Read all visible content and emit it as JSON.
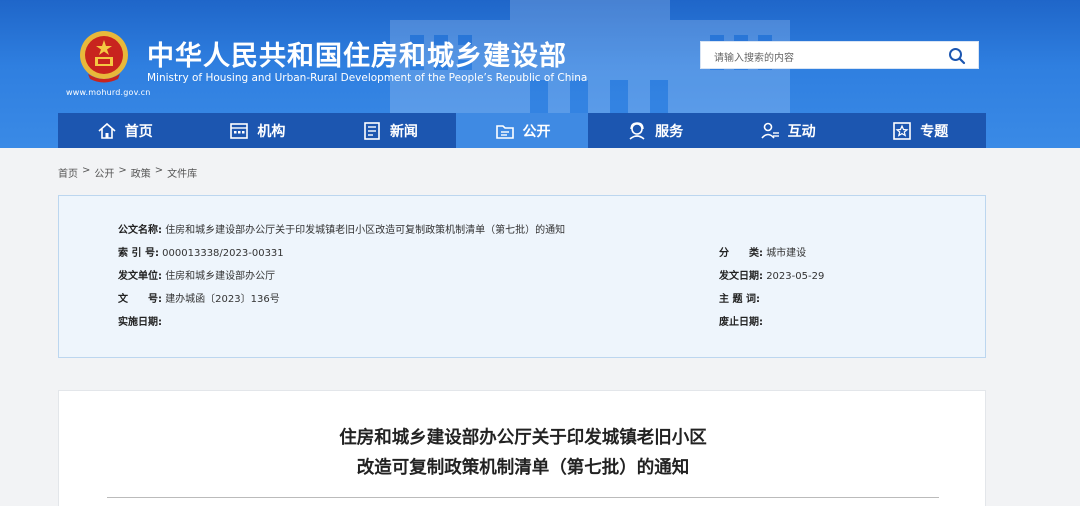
{
  "header": {
    "site_title": "中华人民共和国住房和城乡建设部",
    "site_subtitle": "Ministry of Housing and Urban-Rural Development of the People’s Republic of China",
    "site_url": "www.mohurd.gov.cn",
    "emblem_icon": "national-emblem-icon",
    "colors": {
      "header_bg": "#2f7fe0",
      "nav_bg": "#1c56b0",
      "nav_active": "#3f8ae3"
    }
  },
  "search": {
    "placeholder": "请输入搜索的内容",
    "icon": "search-icon"
  },
  "nav": {
    "items": [
      {
        "label": "首页",
        "icon": "home-icon"
      },
      {
        "label": "机构",
        "icon": "building-icon"
      },
      {
        "label": "新闻",
        "icon": "newspaper-icon"
      },
      {
        "label": "公开",
        "icon": "folder-icon",
        "active": true
      },
      {
        "label": "服务",
        "icon": "service-icon"
      },
      {
        "label": "互动",
        "icon": "interaction-icon"
      },
      {
        "label": "专题",
        "icon": "star-icon"
      }
    ]
  },
  "breadcrumb": {
    "items": [
      "首页",
      "公开",
      "政策",
      "文件库"
    ],
    "separator": ">"
  },
  "info": {
    "doc_name_label": "公文名称:",
    "doc_name_value": "住房和城乡建设部办公厅关于印发城镇老旧小区改造可复制政策机制清单（第七批）的通知",
    "index_label": "索 引 号:",
    "index_value": "000013338/2023-00331",
    "category_label": "分　　类:",
    "category_value": "城市建设",
    "issuer_label": "发文单位:",
    "issuer_value": "住房和城乡建设部办公厅",
    "date_label": "发文日期:",
    "date_value": "2023-05-29",
    "docno_label": "文　　号:",
    "docno_value": "建办城函〔2023〕136号",
    "subject_label": "主 题 词:",
    "subject_value": "",
    "effective_label": "实施日期:",
    "effective_value": "",
    "expiry_label": "废止日期:",
    "expiry_value": ""
  },
  "article": {
    "title_line1": "住房和城乡建设部办公厅关于印发城镇老旧小区",
    "title_line2": "改造可复制政策机制清单（第七批）的通知"
  }
}
